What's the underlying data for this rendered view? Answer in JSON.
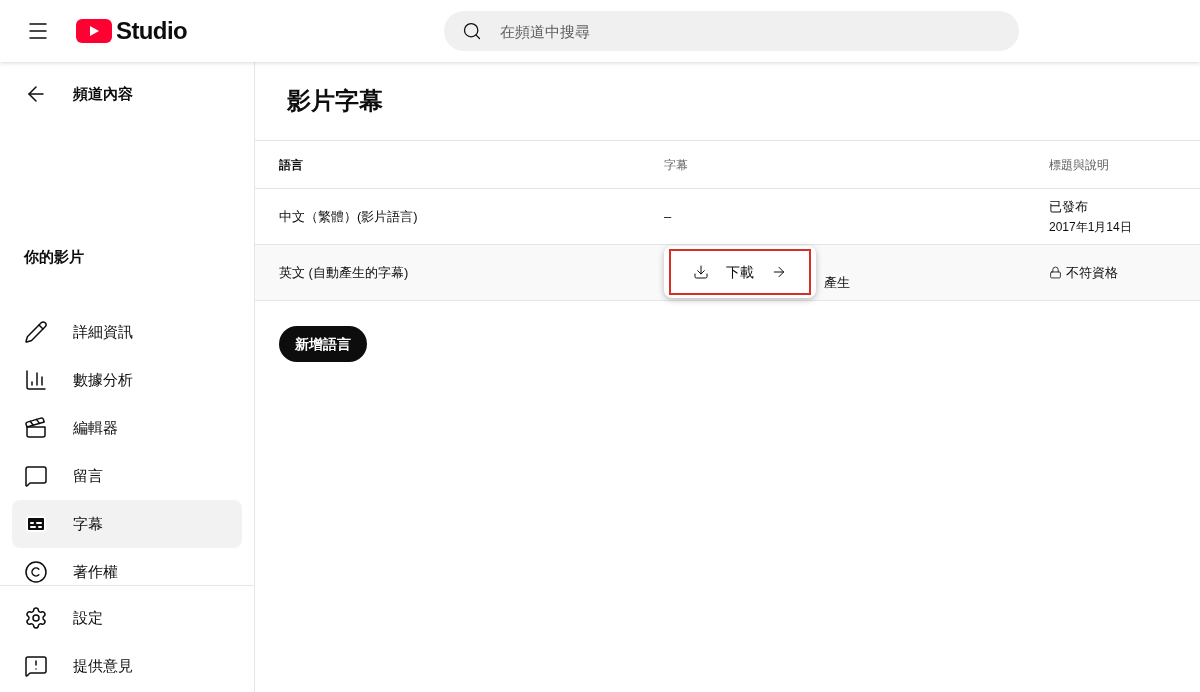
{
  "header": {
    "logo_text": "Studio",
    "search": {
      "placeholder": "在頻道中搜尋"
    }
  },
  "sidebar": {
    "back_label": "頻道內容",
    "section_title": "你的影片",
    "items": [
      {
        "kind": "pencil",
        "label": "詳細資訊",
        "selected": false
      },
      {
        "kind": "chart",
        "label": "數據分析",
        "selected": false
      },
      {
        "kind": "clapper",
        "label": "編輯器",
        "selected": false
      },
      {
        "kind": "comment",
        "label": "留言",
        "selected": false
      },
      {
        "kind": "subtitles",
        "label": "字幕",
        "selected": true
      },
      {
        "kind": "copyright",
        "label": "著作權",
        "selected": false
      }
    ],
    "footer_items": [
      {
        "kind": "gear",
        "label": "設定"
      },
      {
        "kind": "feedback",
        "label": "提供意見"
      }
    ]
  },
  "page_title": "影片字幕",
  "table": {
    "columns": [
      "語言",
      "字幕",
      "標題與說明"
    ],
    "rows": [
      {
        "language": "中文（繁體）(影片語言)",
        "subtitles": "–",
        "title_status": "已發布",
        "title_date": "2017年1月14日",
        "locked": false,
        "highlighted": false
      },
      {
        "language": "英文 (自動產生的字幕)",
        "subtitles": "產生",
        "title_status": "不符資格",
        "locked": true,
        "highlighted": true
      }
    ]
  },
  "popup_menu": {
    "items": [
      {
        "label": "下載",
        "outlined": true
      }
    ]
  },
  "add_language_button": "新增語言"
}
